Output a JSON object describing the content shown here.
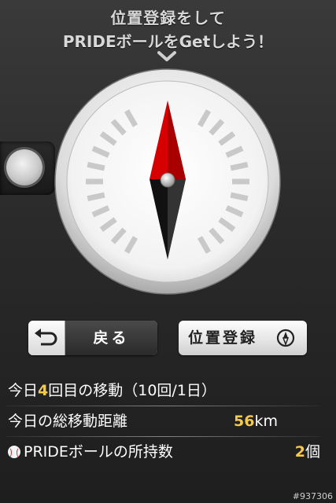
{
  "header": {
    "line1": "位置登録をして",
    "line2": "PRIDEボールをGetしよう！"
  },
  "buttons": {
    "back_label": "戻る",
    "register_label": "位置登録"
  },
  "stats": {
    "move_prefix": "今日",
    "move_count": "4",
    "move_suffix": "回目の移動（10回/1日）",
    "distance_label": "今日の総移動距離",
    "distance_value": "56",
    "distance_unit": "km",
    "balls_label": "PRIDEボールの所持数",
    "balls_value": "2",
    "balls_unit": "個"
  },
  "watermark": "#937306",
  "colors": {
    "accent": "#f6c850",
    "needle_north": "#d60000",
    "needle_south": "#111111"
  },
  "icons": {
    "back": "undo-arrow-icon",
    "register": "compass-icon",
    "ball": "baseball-icon",
    "scroll": "chevron-down-icon"
  }
}
